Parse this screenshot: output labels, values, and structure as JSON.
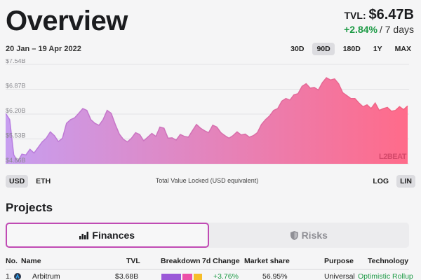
{
  "header": {
    "title": "Overview",
    "tvl_label": "TVL:",
    "tvl_value": "$6.47B",
    "change_value": "+2.84%",
    "change_period": "/ 7 days"
  },
  "date_range": "20 Jan – 19 Apr 2022",
  "range_buttons": [
    {
      "label": "30D",
      "active": false
    },
    {
      "label": "90D",
      "active": true
    },
    {
      "label": "180D",
      "active": false
    },
    {
      "label": "1Y",
      "active": false
    },
    {
      "label": "MAX",
      "active": false
    }
  ],
  "chart_data": {
    "type": "area",
    "y_tick_labels": [
      "$7.54B",
      "$6.87B",
      "$6.20B",
      "$5.53B",
      "$4.86B"
    ],
    "ylim": [
      4.86,
      7.54
    ],
    "values": [
      6.22,
      6.05,
      5.1,
      4.92,
      5.12,
      5.1,
      5.25,
      5.15,
      5.3,
      5.45,
      5.55,
      5.72,
      5.62,
      5.46,
      5.55,
      5.95,
      6.05,
      6.1,
      6.22,
      6.35,
      6.3,
      6.05,
      5.95,
      5.9,
      6.05,
      6.3,
      6.22,
      5.92,
      5.66,
      5.52,
      5.45,
      5.55,
      5.7,
      5.65,
      5.48,
      5.58,
      5.68,
      5.6,
      5.85,
      5.82,
      5.55,
      5.56,
      5.5,
      5.65,
      5.6,
      5.58,
      5.75,
      5.92,
      5.82,
      5.75,
      5.7,
      5.9,
      5.85,
      5.7,
      5.62,
      5.55,
      5.62,
      5.72,
      5.64,
      5.66,
      5.58,
      5.62,
      5.7,
      5.92,
      6.05,
      6.15,
      6.3,
      6.35,
      6.55,
      6.62,
      6.58,
      6.72,
      6.75,
      6.95,
      7.02,
      6.9,
      6.92,
      6.85,
      7.05,
      7.18,
      7.12,
      7.15,
      7.02,
      6.78,
      6.7,
      6.62,
      6.62,
      6.5,
      6.4,
      6.45,
      6.35,
      6.5,
      6.3,
      6.35,
      6.38,
      6.28,
      6.3,
      6.4,
      6.32,
      6.42
    ],
    "caption": "Total Value Locked (USD equivalent)",
    "grid": true,
    "colors": {
      "start": "#c79ef0",
      "end": "#ff6b8a",
      "line_start": "#b67ee2",
      "line_end": "#f3627f"
    }
  },
  "watermark": "L2BEAT",
  "currency_toggles": [
    {
      "label": "USD",
      "active": true
    },
    {
      "label": "ETH",
      "active": false
    }
  ],
  "scale_toggles": [
    {
      "label": "LOG",
      "active": false
    },
    {
      "label": "LIN",
      "active": true
    }
  ],
  "projects": {
    "title": "Projects",
    "tabs": [
      {
        "label": "Finances",
        "icon": "bar-chart-icon",
        "active": true
      },
      {
        "label": "Risks",
        "icon": "shield-icon",
        "active": false
      }
    ],
    "columns": [
      "No.",
      "Name",
      "TVL",
      "Breakdown",
      "7d Change",
      "Market share",
      "Purpose",
      "Technology"
    ],
    "rows": [
      {
        "no": "1.",
        "name": "Arbitrum",
        "tvl": "$3.68B",
        "breakdown_colors": [
          "#9b59d8",
          "#ec4fa8",
          "#f6bd2a"
        ],
        "change": "+3.76%",
        "share": "56.95%",
        "purpose": "Universal",
        "technology": "Optimistic Rollup"
      }
    ]
  }
}
